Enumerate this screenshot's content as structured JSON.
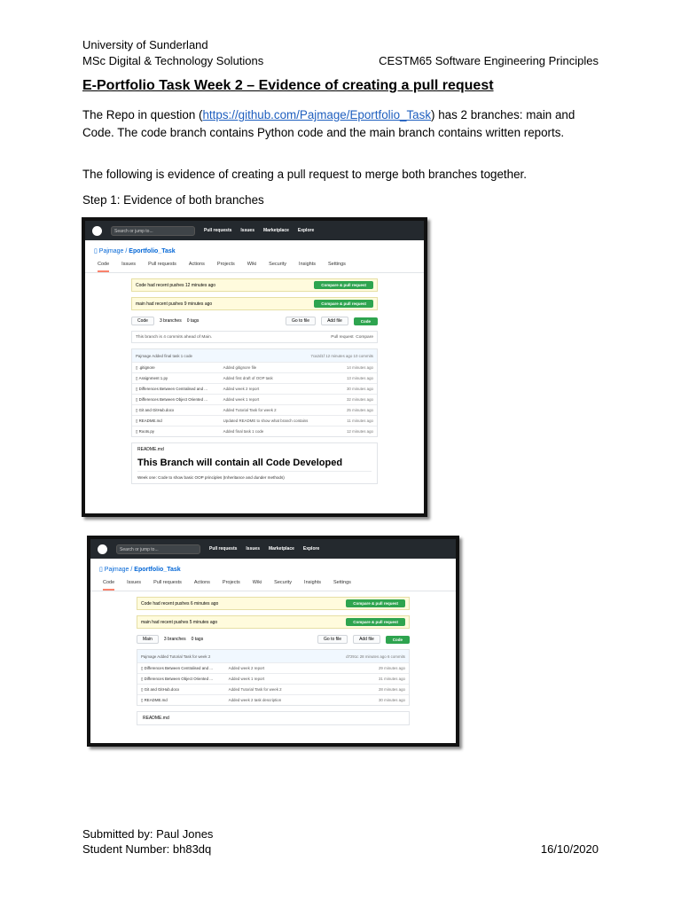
{
  "header": {
    "university": "University of Sunderland",
    "programme": "MSc Digital & Technology Solutions",
    "module": "CESTM65 Software Engineering Principles"
  },
  "title": "E-Portfolio Task Week 2 – Evidence of creating a pull request",
  "intro": {
    "before_link": "The Repo in question (",
    "link": "https://github.com/Pajmage/Eportfolio_Task",
    "after_link": ") has 2 branches: main and Code.  The code branch contains Python code and the main branch contains written reports."
  },
  "para2": "The following is evidence of creating a pull request to merge both branches together.",
  "step1": "Step 1: Evidence of both branches",
  "github": {
    "search": "Search or jump to...",
    "nav": [
      "Pull requests",
      "Issues",
      "Marketplace",
      "Explore"
    ],
    "repo_owner": "Pajmage",
    "repo_name": "Eportfolio_Task",
    "tabs": [
      "Code",
      "Issues",
      "Pull requests",
      "Actions",
      "Projects",
      "Wiki",
      "Security",
      "Insights",
      "Settings"
    ],
    "compare_btn": "Compare & pull request",
    "go_to_file": "Go to file",
    "add_file": "Add file",
    "code_btn": "Code"
  },
  "shot1": {
    "flash1": "Code had recent pushes 12 minutes ago",
    "flash2": "main had recent pushes 9 minutes ago",
    "branch": "Code",
    "branches": "3 branches",
    "tags": "0 tags",
    "ahead": "This branch is 4 commits ahead of Main.",
    "pr": "Pull request",
    "compare": "Compare",
    "commit_head": "Pajmage Added final task 1 code",
    "commit_hash": "7ca2d1f",
    "commit_time": "12 minutes ago",
    "commits": "10 commits",
    "files": [
      {
        "name": ".gitignore",
        "msg": "Added gitignore file",
        "time": "14 minutes ago"
      },
      {
        "name": "Assignment 1.py",
        "msg": "Added first draft of OOP task",
        "time": "13 minutes ago"
      },
      {
        "name": "Differences Between Centralised and ...",
        "msg": "Added week 2 report",
        "time": "30 minutes ago"
      },
      {
        "name": "Differences Between Object Oriented ...",
        "msg": "Added week 1 report",
        "time": "32 minutes ago"
      },
      {
        "name": "Git and GitHub.docx",
        "msg": "Added Tutorial Task for week 2",
        "time": "25 minutes ago"
      },
      {
        "name": "README.md",
        "msg": "Updated README to show what branch contains",
        "time": "11 minutes ago"
      },
      {
        "name": "Roots.py",
        "msg": "Added final task 1 code",
        "time": "12 minutes ago"
      }
    ],
    "readme_label": "README.md",
    "readme_heading": "This Branch will contain all Code Developed",
    "readme_text": "Week one: Code to show basic OOP principles (Inheritance and dunder methods)"
  },
  "shot2": {
    "flash1": "Code had recent pushes 6 minutes ago",
    "flash2": "main had recent pushes 5 minutes ago",
    "branch": "Main",
    "branches": "3 branches",
    "tags": "0 tags",
    "commit_head": "Pajmage Added Tutorial Task for week 2",
    "commit_hash": "d7291c",
    "commit_time": "28 minutes ago",
    "commits": "6 commits",
    "files": [
      {
        "name": "Differences Between Centralised and ...",
        "msg": "Added week 2 report",
        "time": "29 minutes ago"
      },
      {
        "name": "Differences Between Object Oriented ...",
        "msg": "Added week 1 report",
        "time": "31 minutes ago"
      },
      {
        "name": "Git and GitHub.docx",
        "msg": "Added Tutorial Task for week 2",
        "time": "28 minutes ago"
      },
      {
        "name": "README.md",
        "msg": "Added week 2 task description",
        "time": "30 minutes ago"
      }
    ],
    "readme_label": "README.md"
  },
  "footer": {
    "submitted": "Submitted by: Paul Jones",
    "student": "Student Number: bh83dq",
    "date": "16/10/2020"
  }
}
